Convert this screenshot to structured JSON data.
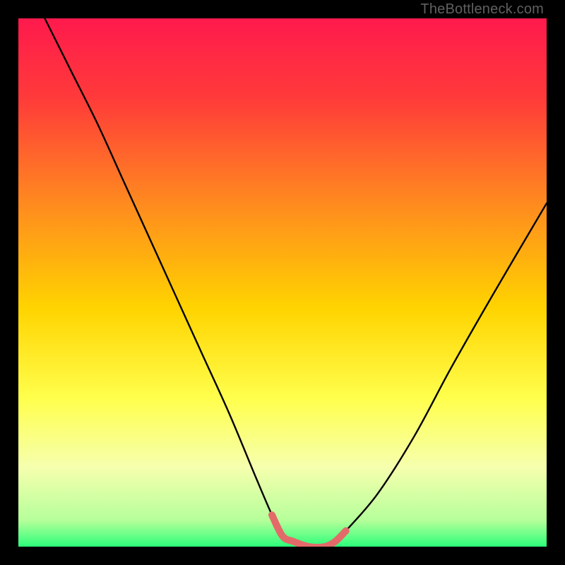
{
  "attribution": "TheBottleneck.com",
  "colors": {
    "bg_frame": "#000000",
    "grad_top": "#ff1a4d",
    "grad_mid1": "#ff7a29",
    "grad_mid2": "#ffd400",
    "grad_mid3": "#ffff66",
    "grad_mid4": "#f2ffb3",
    "grad_bottom": "#2cff7a",
    "curve": "#000000",
    "highlight": "#e46a6a",
    "attribution": "#606060"
  },
  "chart_data": {
    "type": "line",
    "title": "",
    "xlabel": "",
    "ylabel": "",
    "xlim": [
      0,
      100
    ],
    "ylim": [
      0,
      100
    ],
    "series": [
      {
        "name": "bottleneck-curve",
        "x": [
          5,
          10,
          15,
          20,
          25,
          30,
          35,
          40,
          45,
          48,
          50,
          52,
          55,
          58,
          60,
          62,
          68,
          75,
          82,
          90,
          100
        ],
        "y": [
          100,
          90,
          80,
          69,
          58,
          47,
          36,
          25,
          13,
          6,
          2,
          1,
          0,
          0,
          1,
          3,
          10,
          21,
          34,
          48,
          65
        ]
      }
    ],
    "highlight_segment": {
      "name": "optimal-range",
      "x": [
        48,
        50,
        52,
        55,
        58,
        60,
        62
      ],
      "y": [
        6,
        2,
        1,
        0,
        0,
        1,
        3
      ]
    },
    "notes": "Values estimated from pixel positions; no axis ticks or labels present; background is a vertical heat gradient from red (top) through orange/yellow to green (bottom)."
  }
}
